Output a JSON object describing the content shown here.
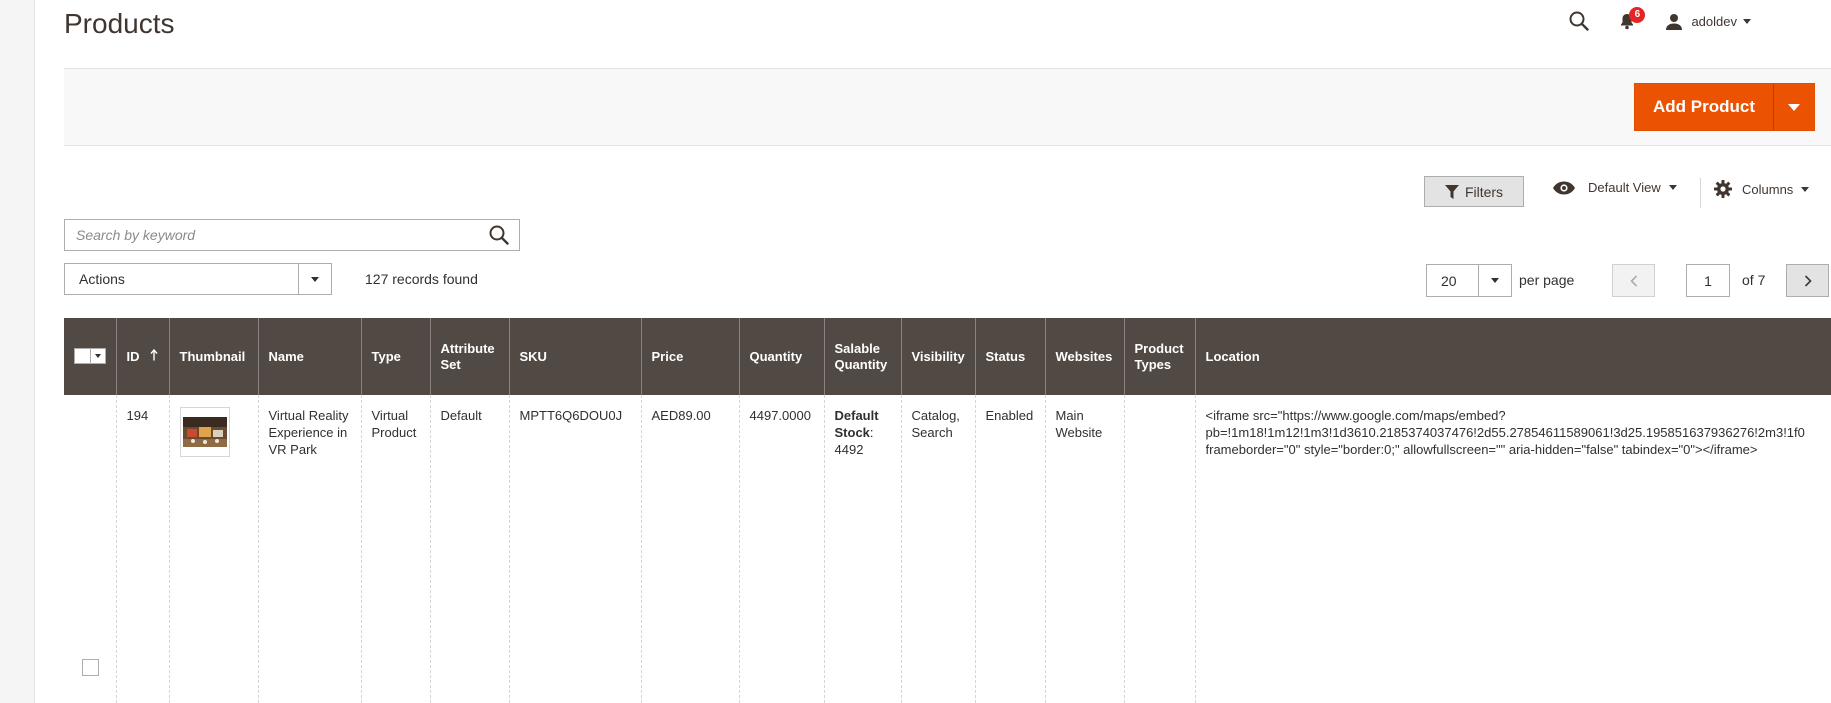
{
  "header": {
    "title": "Products",
    "notifications_count": "6",
    "username": "adoldev"
  },
  "action_band": {
    "add_product_label": "Add Product"
  },
  "toolbar": {
    "filters_label": "Filters",
    "view_label": "Default View",
    "columns_label": "Columns",
    "search_placeholder": "Search by keyword",
    "actions_label": "Actions",
    "records_found": "127 records found",
    "per_page_value": "20",
    "per_page_label": "per page",
    "current_page": "1",
    "page_of": "of 7"
  },
  "grid": {
    "columns": {
      "id": "ID",
      "thumbnail": "Thumbnail",
      "name": "Name",
      "type": "Type",
      "attribute_set": "Attribute Set",
      "sku": "SKU",
      "price": "Price",
      "quantity": "Quantity",
      "salable_quantity": "Salable Quantity",
      "visibility": "Visibility",
      "status": "Status",
      "websites": "Websites",
      "product_types": "Product Types",
      "location": "Location"
    },
    "rows": [
      {
        "id": "194",
        "name": "Virtual Reality Experience in VR Park",
        "type": "Virtual Product",
        "attribute_set": "Default",
        "sku": "MPTT6Q6DOU0J",
        "price": "AED89.00",
        "quantity": "4497.0000",
        "salable_stock_label": "Default Stock",
        "salable_stock_value": "4492",
        "visibility": "Catalog, Search",
        "status": "Enabled",
        "websites": "Main Website",
        "product_types": "",
        "location_line1": "<iframe src=\"https://www.google.com/maps/embed?",
        "location_line2": "pb=!1m18!1m12!1m3!1d3610.2185374037476!2d55.27854611589061!3d25.195851637936276!2m3!1f0",
        "location_line3": "frameborder=\"0\" style=\"border:0;\" allowfullscreen=\"\" aria-hidden=\"false\" tabindex=\"0\"></iframe>"
      }
    ]
  },
  "colors": {
    "accent": "#eb5202",
    "grid_header": "#514943",
    "badge": "#e22626"
  }
}
